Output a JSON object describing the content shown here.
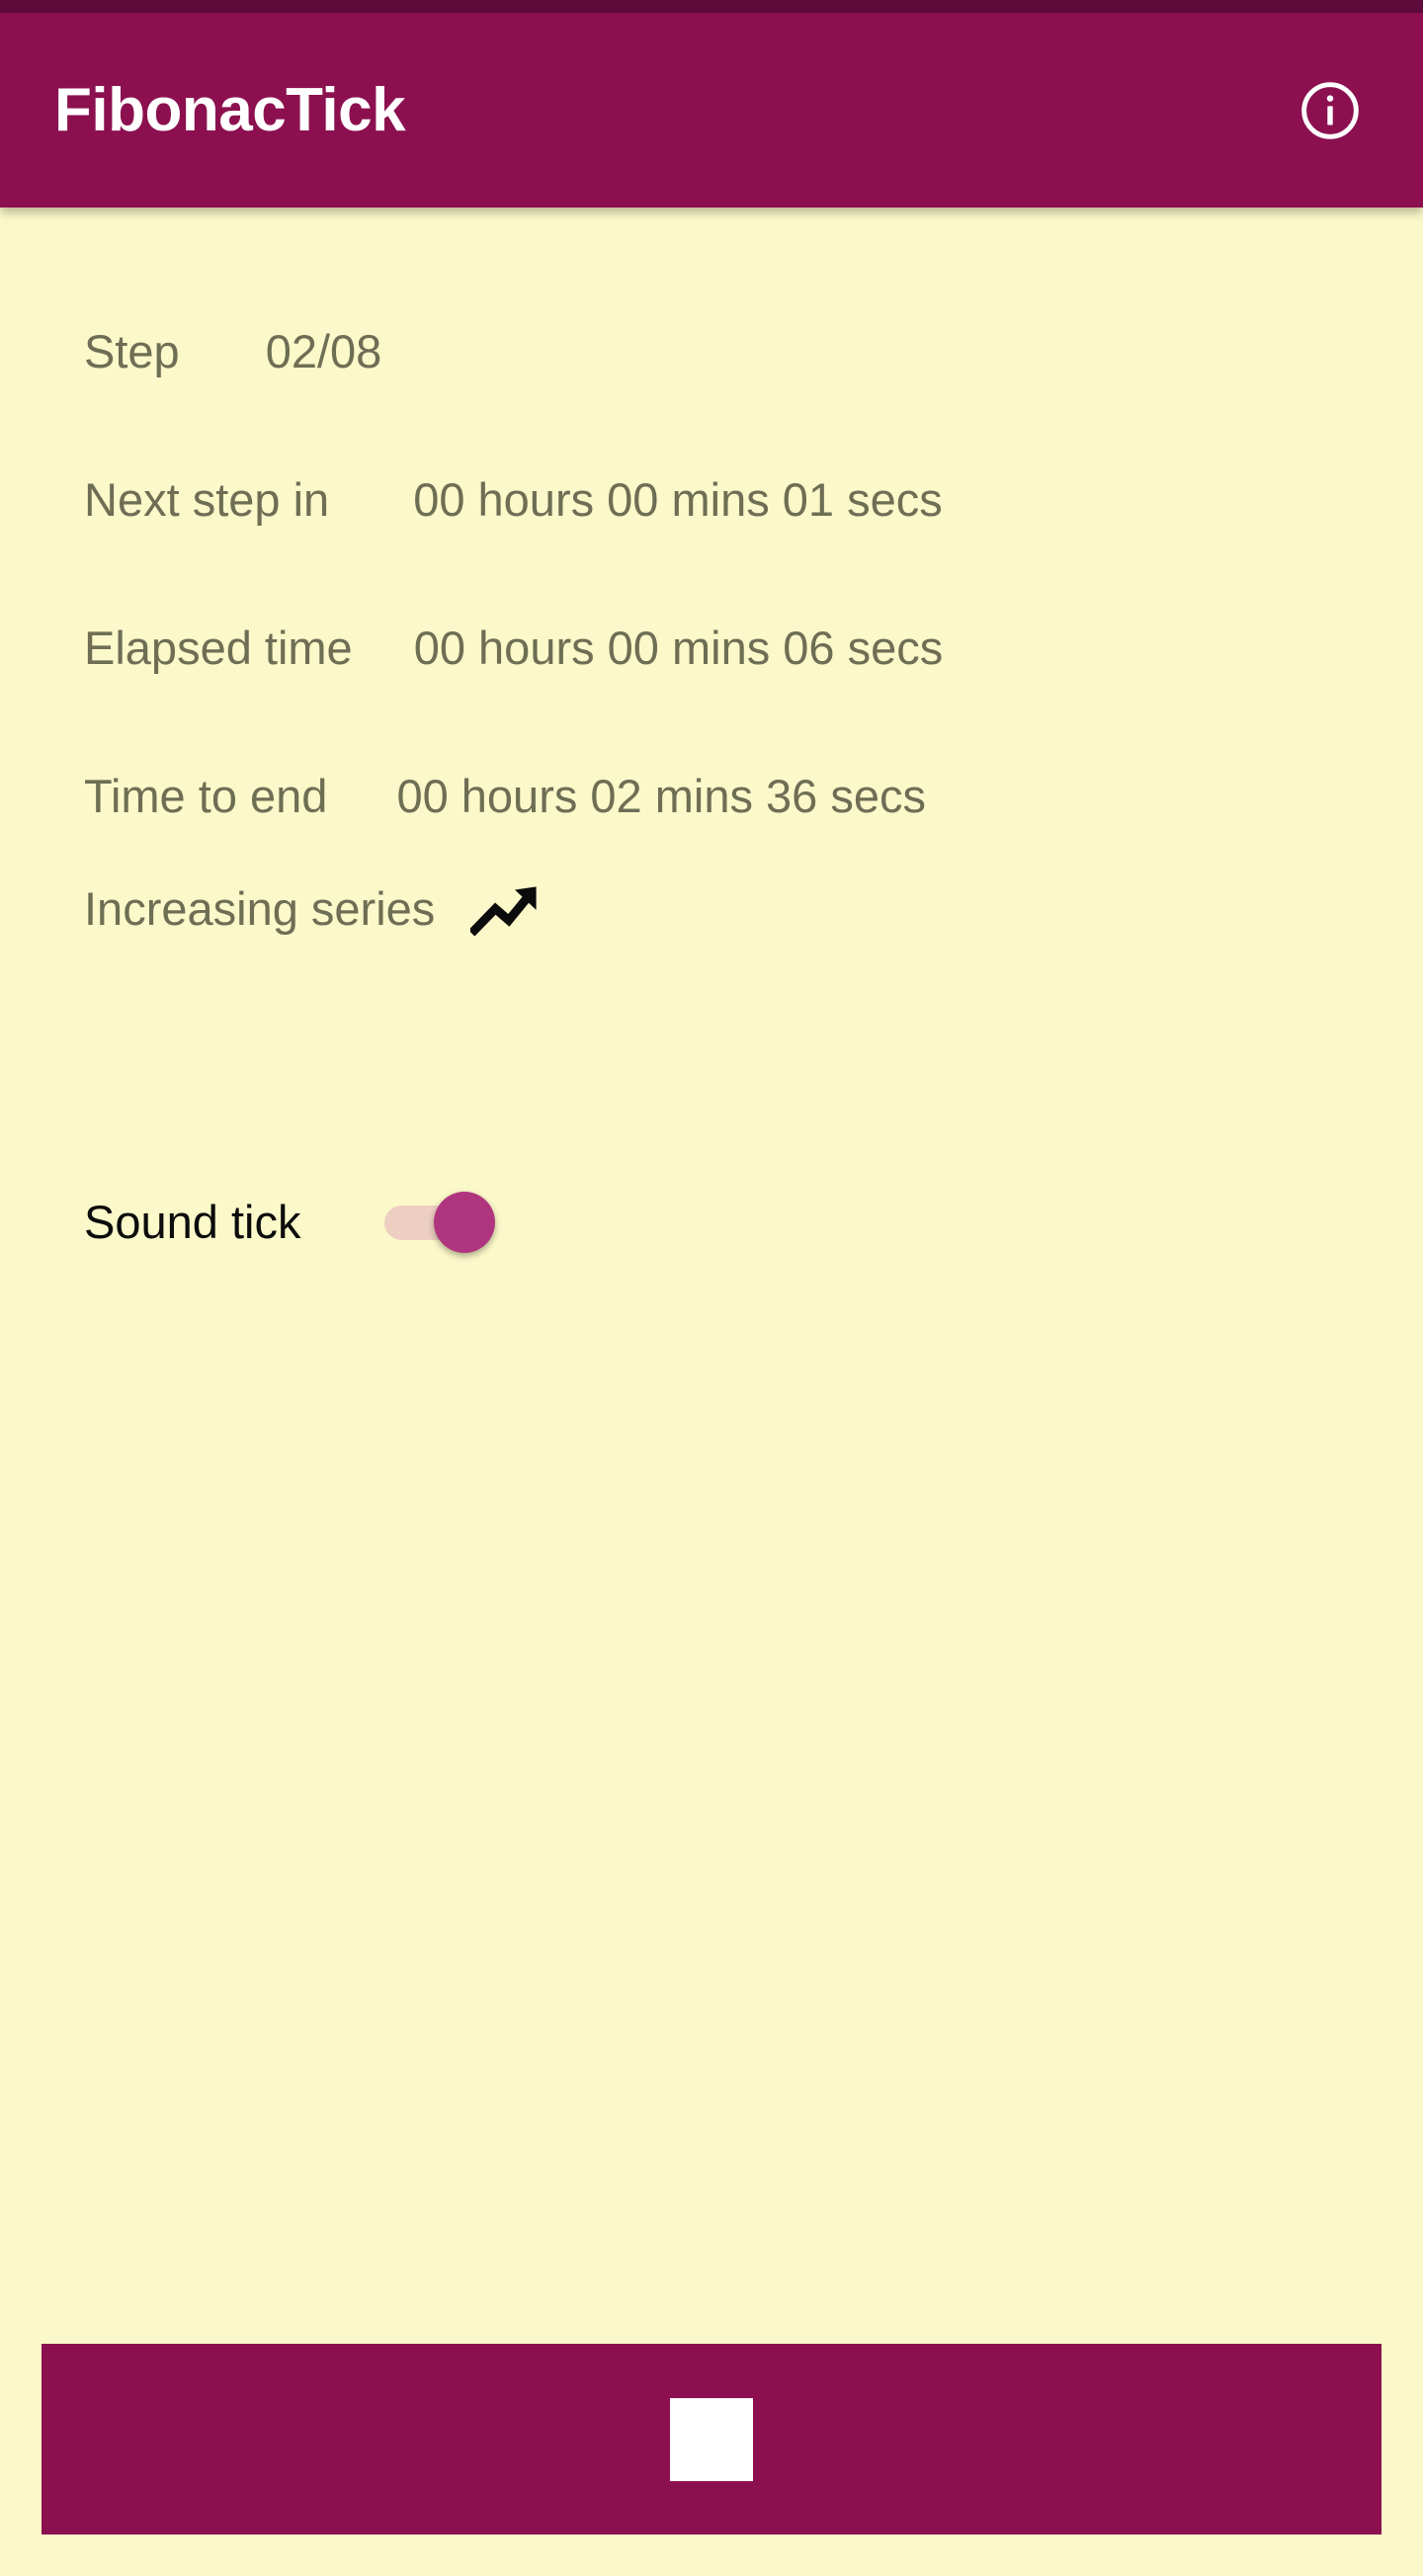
{
  "app": {
    "title": "FibonacTick",
    "accent_color": "#8c1050",
    "status_bar_color": "#5e0a3a",
    "background_color": "#fbf8c9",
    "text_color": "#6e6e55"
  },
  "app_bar": {
    "title": "FibonacTick",
    "info_icon": "info-circle-icon"
  },
  "rows": {
    "step": {
      "label": "Step",
      "value": "02/08"
    },
    "next_step": {
      "label": "Next step in",
      "value": "00 hours 00 mins 01 secs"
    },
    "elapsed": {
      "label": "Elapsed time",
      "value": "00 hours 00 mins 06 secs"
    },
    "time_to_end": {
      "label": "Time to end",
      "value": "00 hours 02 mins 36 secs"
    },
    "series": {
      "label": "Increasing series",
      "icon": "trending-up-icon"
    },
    "sound": {
      "label": "Sound tick",
      "state": "on",
      "track_color": "#edcfc1",
      "thumb_color": "#b0357f"
    }
  },
  "bottom_button": {
    "icon": "stop-square-icon",
    "label": "",
    "background_color": "#8c1050",
    "icon_color": "#ffffff"
  }
}
